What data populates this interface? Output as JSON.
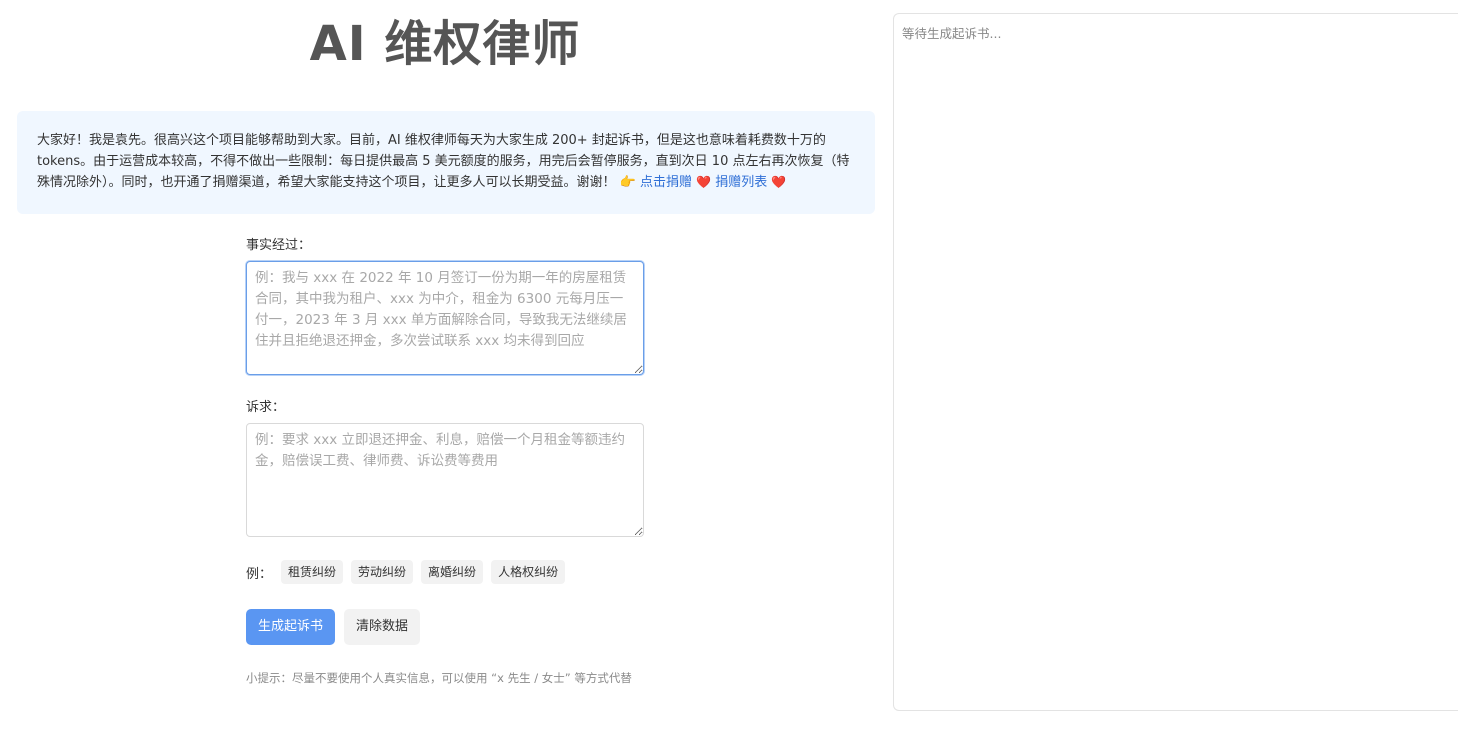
{
  "header": {
    "title": "AI 维权律师"
  },
  "notice": {
    "text": "大家好！我是袁先。很高兴这个项目能够帮助到大家。目前，AI 维权律师每天为大家生成 200+ 封起诉书，但是这也意味着耗费数十万的 tokens。由于运营成本较高，不得不做出一些限制：每日提供最高 5 美元额度的服务，用完后会暂停服务，直到次日 10 点左右再次恢复（特殊情况除外）。同时，也开通了捐赠渠道，希望大家能支持这个项目，让更多人可以长期受益。谢谢！",
    "point_icon": "point-right-icon",
    "donate_link": "点击捐赠",
    "heart_icon": "heart-icon",
    "donation_list_link": "捐赠列表",
    "link_color": "#2f6fd6"
  },
  "form": {
    "facts_label": "事实经过：",
    "facts_placeholder": "例：我与 xxx 在 2022 年 10 月签订一份为期一年的房屋租赁合同，其中我为租户、xxx 为中介，租金为 6300 元每月压一付一，2023 年 3 月 xxx 单方面解除合同，导致我无法继续居住并且拒绝退还押金，多次尝试联系 xxx 均未得到回应",
    "facts_value": "",
    "claims_label": "诉求：",
    "claims_placeholder": "例：要求 xxx 立即退还押金、利息，赔偿一个月租金等额违约金，赔偿误工费、律师费、诉讼费等费用",
    "claims_value": "",
    "examples_prefix": "例：",
    "examples": [
      "租赁纠纷",
      "劳动纠纷",
      "离婚纠纷",
      "人格权纠纷"
    ],
    "generate_button": "生成起诉书",
    "clear_button": "清除数据",
    "tip": "小提示：尽量不要使用个人真实信息，可以使用 “x 先生 / 女士” 等方式代替",
    "primary_color": "#5a96f2"
  },
  "output": {
    "placeholder": "等待生成起诉书..."
  }
}
